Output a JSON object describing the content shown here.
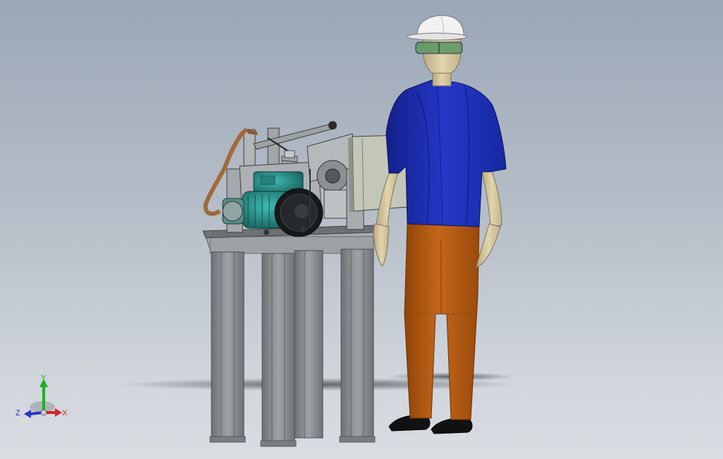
{
  "viewport": {
    "background_top": "#9ba7b6",
    "background_bottom": "#dadde2"
  },
  "triad": {
    "x_label": "X",
    "y_label": "Y",
    "z_label": "Z",
    "x_color": "#d62020",
    "y_color": "#1fae2a",
    "z_color": "#2a35c8"
  },
  "scene": {
    "machine": "belt-grinder-on-stand",
    "figure": "human-mannequin-with-hard-hat",
    "colors": {
      "shirt": "#1d2fb0",
      "pants": "#b65a10",
      "skin": "#d9c9a0",
      "motor": "#2a8f8a",
      "stand": "#8a8d90",
      "belt": "#b07840",
      "cabinet": "#b9bcae"
    }
  }
}
